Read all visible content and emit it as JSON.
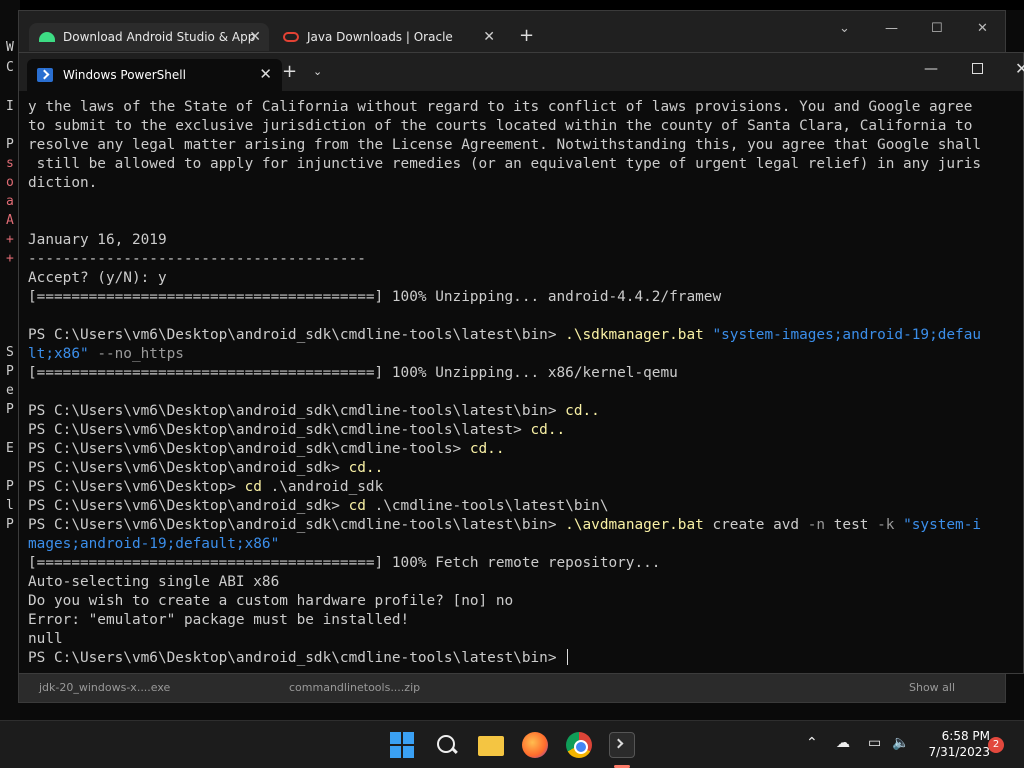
{
  "desktop": {
    "left_edge_chars": [
      "W",
      "C",
      "I",
      "P",
      "s",
      "o",
      "a",
      "A",
      "+",
      "+",
      "S",
      "P",
      "e",
      "P",
      "E",
      "P",
      "l",
      "P"
    ]
  },
  "browser": {
    "tabs": [
      {
        "label": "Download Android Studio & App",
        "icon": "android-icon"
      },
      {
        "label": "Java Downloads | Oracle",
        "icon": "oracle-icon"
      }
    ],
    "downloads": [
      "jdk-20_windows-x....exe",
      "commandlinetools....zip",
      "Show all"
    ]
  },
  "terminal": {
    "tab_label": "Windows PowerShell",
    "lines": [
      [
        {
          "t": "y the laws of the State of California without regard to its conflict of laws provisions. You and Google agree"
        }
      ],
      [
        {
          "t": "to submit to the exclusive jurisdiction of the courts located within the county of Santa Clara, California to"
        }
      ],
      [
        {
          "t": "resolve any legal matter arising from the License Agreement. Notwithstanding this, you agree that Google shall"
        }
      ],
      [
        {
          "t": " still be allowed to apply for injunctive remedies (or an equivalent type of urgent legal relief) in any juris"
        }
      ],
      [
        {
          "t": "diction."
        }
      ],
      [
        {
          "t": ""
        }
      ],
      [
        {
          "t": ""
        }
      ],
      [
        {
          "t": "January 16, 2019"
        }
      ],
      [
        {
          "t": "---------------------------------------"
        }
      ],
      [
        {
          "t": "Accept? (y/N): y"
        }
      ],
      [
        {
          "t": "[=======================================] 100% Unzipping... android-4.4.2/framew"
        }
      ],
      [
        {
          "t": ""
        }
      ],
      [
        {
          "t": "PS C:\\Users\\vm6\\Desktop\\android_sdk\\cmdline-tools\\latest\\bin> "
        },
        {
          "t": ".\\sdkmanager.bat",
          "c": "y"
        },
        {
          "t": " "
        },
        {
          "t": "\"system-images;android-19;defau",
          "c": "b"
        }
      ],
      [
        {
          "t": "lt;x86\"",
          "c": "b"
        },
        {
          "t": " --no_https",
          "c": "g"
        }
      ],
      [
        {
          "t": "[=======================================] 100% Unzipping... x86/kernel-qemu"
        }
      ],
      [
        {
          "t": ""
        }
      ],
      [
        {
          "t": "PS C:\\Users\\vm6\\Desktop\\android_sdk\\cmdline-tools\\latest\\bin> "
        },
        {
          "t": "cd..",
          "c": "y"
        }
      ],
      [
        {
          "t": "PS C:\\Users\\vm6\\Desktop\\android_sdk\\cmdline-tools\\latest> "
        },
        {
          "t": "cd..",
          "c": "y"
        }
      ],
      [
        {
          "t": "PS C:\\Users\\vm6\\Desktop\\android_sdk\\cmdline-tools> "
        },
        {
          "t": "cd..",
          "c": "y"
        }
      ],
      [
        {
          "t": "PS C:\\Users\\vm6\\Desktop\\android_sdk> "
        },
        {
          "t": "cd..",
          "c": "y"
        }
      ],
      [
        {
          "t": "PS C:\\Users\\vm6\\Desktop> "
        },
        {
          "t": "cd",
          "c": "y"
        },
        {
          "t": " .\\android_sdk"
        }
      ],
      [
        {
          "t": "PS C:\\Users\\vm6\\Desktop\\android_sdk> "
        },
        {
          "t": "cd",
          "c": "y"
        },
        {
          "t": " .\\cmdline-tools\\latest\\bin\\"
        }
      ],
      [
        {
          "t": "PS C:\\Users\\vm6\\Desktop\\android_sdk\\cmdline-tools\\latest\\bin> "
        },
        {
          "t": ".\\avdmanager.bat",
          "c": "y"
        },
        {
          "t": " create avd "
        },
        {
          "t": "-n",
          "c": "g"
        },
        {
          "t": " test "
        },
        {
          "t": "-k",
          "c": "g"
        },
        {
          "t": " "
        },
        {
          "t": "\"system-i",
          "c": "b"
        }
      ],
      [
        {
          "t": "mages;android-19;default;x86\"",
          "c": "b"
        }
      ],
      [
        {
          "t": "[=======================================] 100% Fetch remote repository..."
        }
      ],
      [
        {
          "t": "Auto-selecting single ABI x86"
        }
      ],
      [
        {
          "t": "Do you wish to create a custom hardware profile? [no] no"
        }
      ],
      [
        {
          "t": "Error: \"emulator\" package must be installed!"
        }
      ],
      [
        {
          "t": "null"
        }
      ],
      [
        {
          "t": "PS C:\\Users\\vm6\\Desktop\\android_sdk\\cmdline-tools\\latest\\bin> "
        }
      ]
    ]
  },
  "taskbar": {
    "time": "6:58 PM",
    "date": "7/31/2023",
    "notification_count": "2",
    "colors": {
      "accent": "#3aa0f3",
      "active_indicator": "#fd7c6a"
    }
  }
}
